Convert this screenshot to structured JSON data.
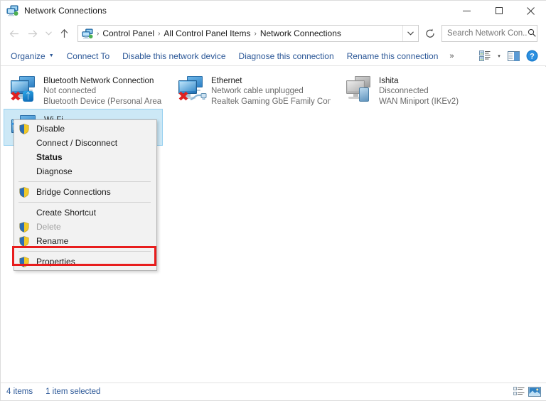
{
  "window": {
    "title": "Network Connections",
    "title_icon": "network-connections-icon",
    "minimize_label": "Minimize",
    "maximize_label": "Maximize",
    "close_label": "Close"
  },
  "navigation": {
    "back_icon": "arrow-left-icon",
    "forward_icon": "arrow-right-icon",
    "recent_icon": "chevron-down-icon",
    "up_icon": "arrow-up-icon",
    "breadcrumbs": [
      "Control Panel",
      "All Control Panel Items",
      "Network Connections"
    ],
    "separator": "›",
    "dropdown_icon": "chevron-down-icon",
    "refresh_icon": "refresh-icon",
    "refresh_label": "Refresh"
  },
  "search": {
    "placeholder": "Search Network Con...",
    "value": "",
    "icon": "search-icon"
  },
  "toolbar": {
    "organize": "Organize",
    "connect_to": "Connect To",
    "disable_device": "Disable this network device",
    "diagnose": "Diagnose this connection",
    "rename": "Rename this connection",
    "overflow": "»",
    "view_icon": "view-options-icon",
    "view_caret": "▾",
    "preview_pane_icon": "preview-pane-icon",
    "help_icon": "help-icon",
    "help_glyph": "?"
  },
  "connections": [
    {
      "name": "Bluetooth Network Connection",
      "status": "Not connected",
      "device": "Bluetooth Device (Personal Area ...",
      "icon": "network-adapter-icon",
      "badge": "bluetooth-badge-icon",
      "error": true,
      "selected": false
    },
    {
      "name": "Ethernet",
      "status": "Network cable unplugged",
      "device": "Realtek Gaming GbE Family Contr...",
      "icon": "network-adapter-icon",
      "badge": "network-cable-badge-icon",
      "error": true,
      "selected": false
    },
    {
      "name": "Ishita",
      "status": "Disconnected",
      "device": "WAN Miniport (IKEv2)",
      "icon": "vpn-adapter-icon",
      "badge": "vpn-badge-icon",
      "error": false,
      "selected": false
    },
    {
      "name": "Wi-Fi",
      "status": "",
      "device": "",
      "icon": "wireless-adapter-icon",
      "badge": "wifi-badge-icon",
      "error": false,
      "selected": true
    }
  ],
  "context_menu": {
    "items": [
      {
        "label": "Disable",
        "shield": true,
        "bold": false,
        "disabled": false
      },
      {
        "label": "Connect / Disconnect",
        "shield": false,
        "bold": false,
        "disabled": false
      },
      {
        "label": "Status",
        "shield": false,
        "bold": true,
        "disabled": false
      },
      {
        "label": "Diagnose",
        "shield": false,
        "bold": false,
        "disabled": false
      },
      {
        "separator": true
      },
      {
        "label": "Bridge Connections",
        "shield": true,
        "bold": false,
        "disabled": false
      },
      {
        "separator": true
      },
      {
        "label": "Create Shortcut",
        "shield": false,
        "bold": false,
        "disabled": false
      },
      {
        "label": "Delete",
        "shield": true,
        "bold": false,
        "disabled": true
      },
      {
        "label": "Rename",
        "shield": true,
        "bold": false,
        "disabled": false
      },
      {
        "label": "Properties",
        "shield": true,
        "bold": false,
        "disabled": false,
        "highlighted": true
      }
    ]
  },
  "annotation": {
    "color": "#e81d1d",
    "target": "Properties"
  },
  "statusbar": {
    "item_count": "4 items",
    "selection": "1 item selected",
    "details_view_icon": "details-view-icon",
    "large_icons_view_icon": "large-icons-view-icon"
  },
  "colors": {
    "accent": "#2b5797",
    "selection": "#cce8f6",
    "annotation": "#e81d1d"
  }
}
